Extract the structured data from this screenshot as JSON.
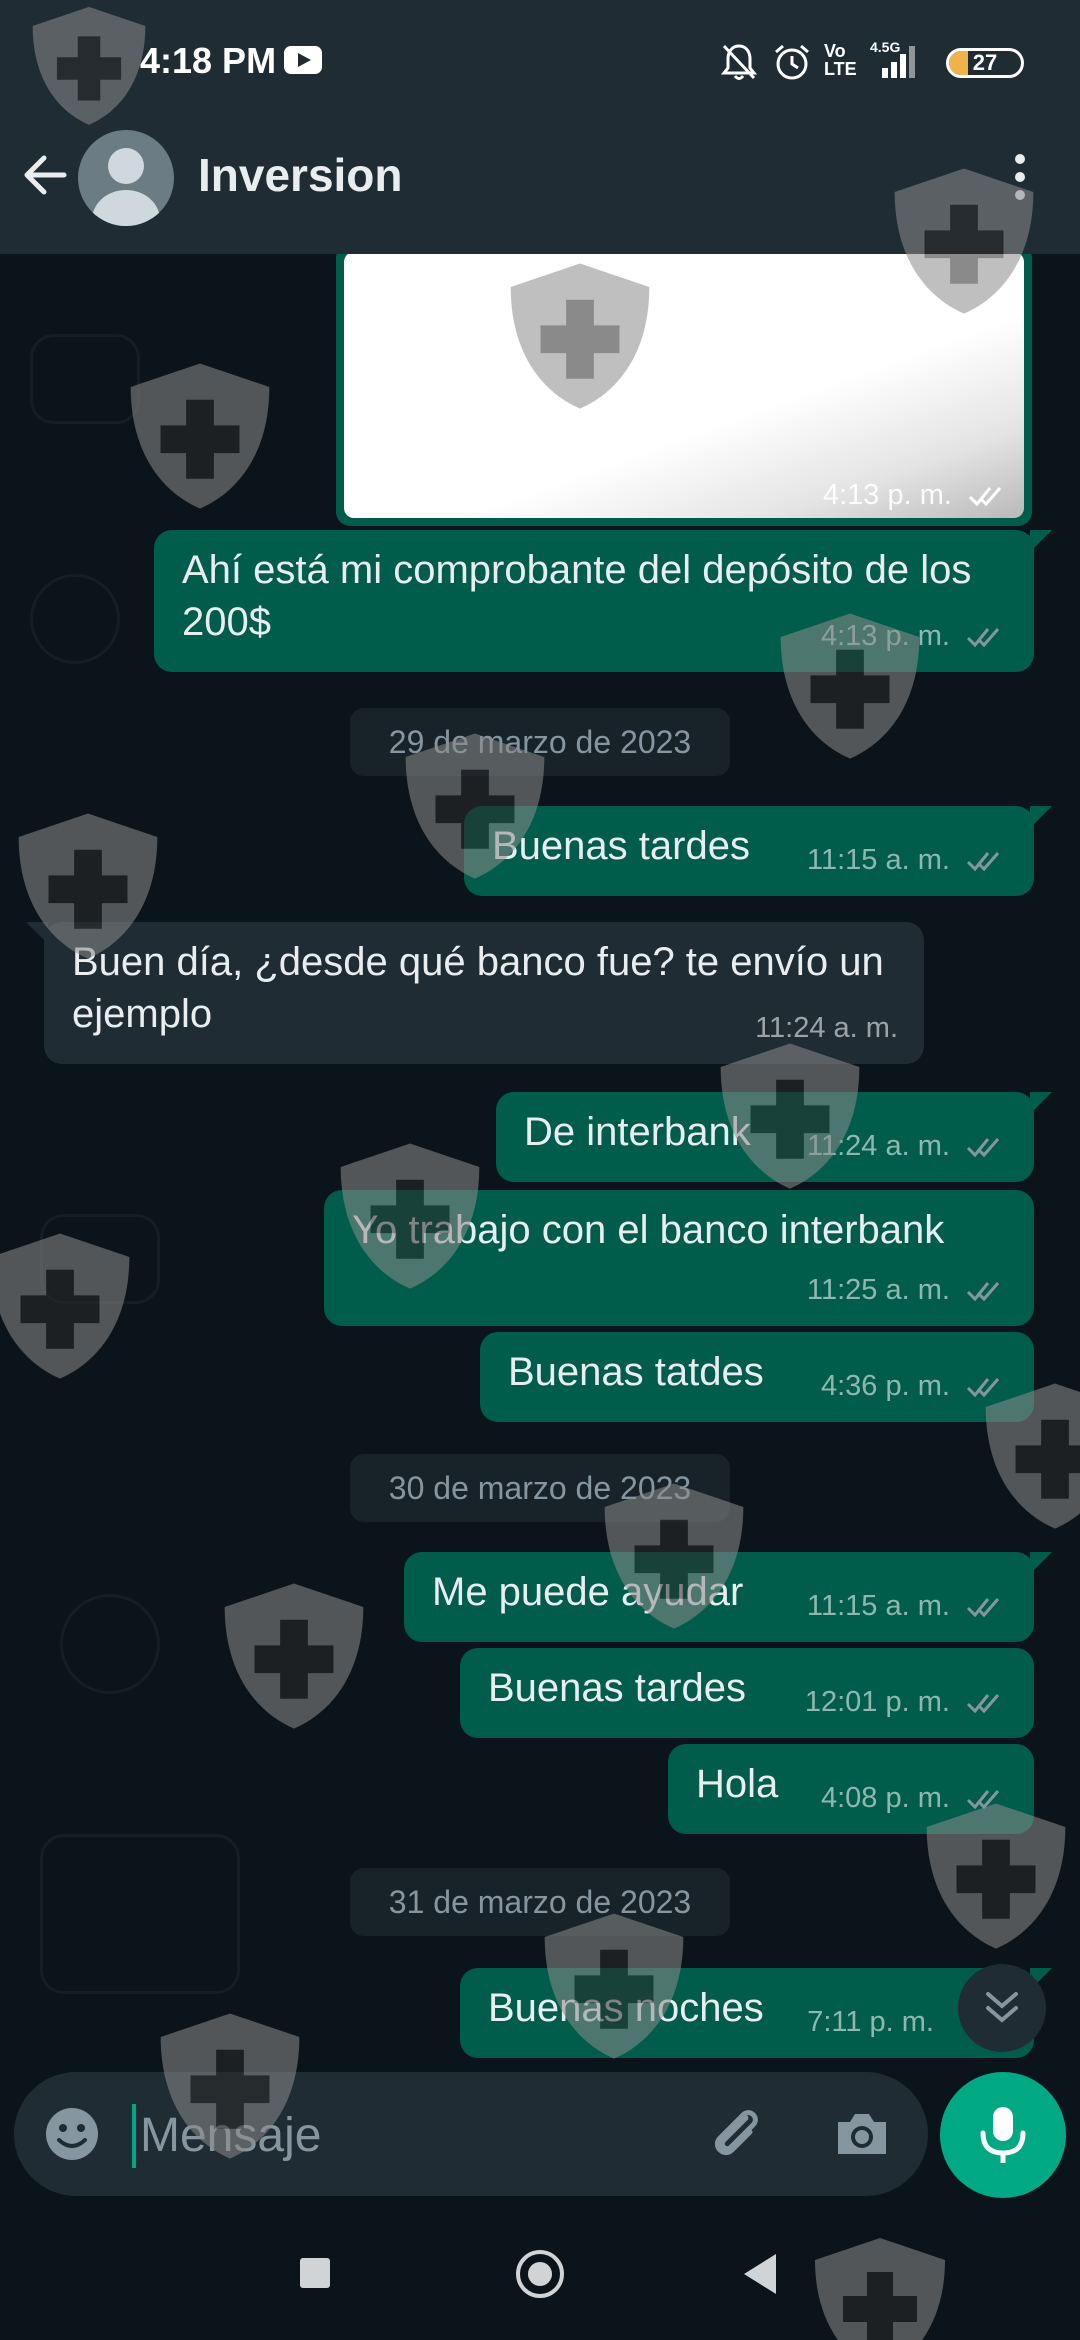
{
  "status_bar": {
    "time": "4:18 PM",
    "network_label": "Vo LTE",
    "network_type": "4.5G",
    "battery": "27",
    "icons": [
      "youtube-icon",
      "mute-bell-icon",
      "alarm-icon",
      "signal-icon",
      "battery-icon"
    ]
  },
  "header": {
    "contact_name": "Inversion",
    "icons": [
      "back-arrow-icon",
      "avatar-icon",
      "more-vert-icon"
    ]
  },
  "chat": {
    "image_message": {
      "time": "4:13 p. m."
    },
    "messages": [
      {
        "text": "Ahí está mi comprobante del depósito de los 200$",
        "time": "4:13 p. m.",
        "direction": "out"
      },
      {
        "date": "29 de marzo de 2023"
      },
      {
        "text": "Buenas tardes",
        "time": "11:15 a. m.",
        "direction": "out"
      },
      {
        "text": "Buen día, ¿desde qué banco fue? te envío un ejemplo",
        "time": "11:24 a. m.",
        "direction": "in"
      },
      {
        "text": "De interbank",
        "time": "11:24 a. m.",
        "direction": "out"
      },
      {
        "text": "Yo trabajo con el banco interbank",
        "time": "11:25 a. m.",
        "direction": "out"
      },
      {
        "text": "Buenas tatdes",
        "time": "4:36 p. m.",
        "direction": "out"
      },
      {
        "date": "30 de marzo de 2023"
      },
      {
        "text": "Me puede ayudar",
        "time": "11:15 a. m.",
        "direction": "out"
      },
      {
        "text": "Buenas tardes",
        "time": "12:01 p. m.",
        "direction": "out"
      },
      {
        "text": "Hola",
        "time": "4:08 p. m.",
        "direction": "out"
      },
      {
        "date": "31 de marzo de 2023"
      },
      {
        "text": "Buenas noches",
        "time": "7:11 p. m.",
        "direction": "out"
      }
    ]
  },
  "composer": {
    "placeholder": "Mensaje",
    "icons": [
      "emoji-icon",
      "attach-icon",
      "camera-icon",
      "mic-icon"
    ]
  },
  "colors": {
    "app_bar": "#1f2c34",
    "background": "#0b141a",
    "outgoing_bubble": "#005c4b",
    "incoming_bubble": "#202c33",
    "accent": "#00a884"
  }
}
